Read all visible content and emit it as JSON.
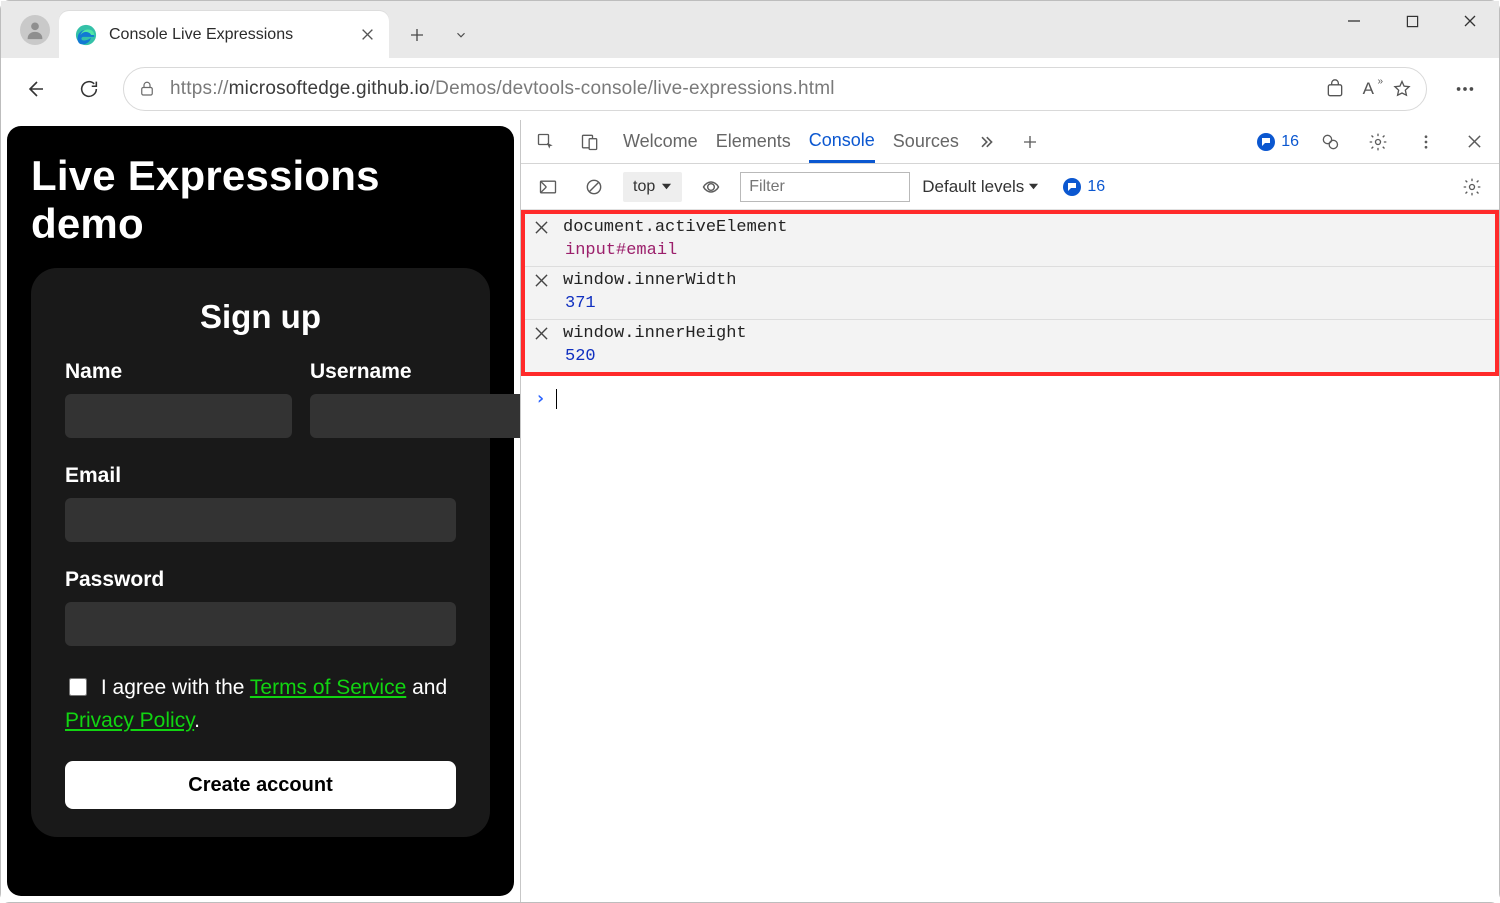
{
  "browser": {
    "tab_title": "Console Live Expressions",
    "url_scheme": "https://",
    "url_host": "microsoftedge.github.io",
    "url_path": "/Demos/devtools-console/live-expressions.html"
  },
  "page": {
    "heading": "Live Expressions demo",
    "form": {
      "title": "Sign up",
      "name_label": "Name",
      "username_label": "Username",
      "email_label": "Email",
      "password_label": "Password",
      "agree_prefix": "I agree with the ",
      "tos_link": "Terms of Service",
      "agree_mid": " and ",
      "privacy_link": "Privacy Policy",
      "agree_suffix": ".",
      "submit_label": "Create account"
    }
  },
  "devtools": {
    "tabs": {
      "welcome": "Welcome",
      "elements": "Elements",
      "console": "Console",
      "sources": "Sources"
    },
    "issues_count": "16",
    "console": {
      "context_label": "top",
      "filter_placeholder": "Filter",
      "levels_label": "Default levels",
      "issues_count": "16",
      "live_expressions": [
        {
          "expr": "document.activeElement",
          "result": "input#email",
          "type": "object"
        },
        {
          "expr": "window.innerWidth",
          "result": "371",
          "type": "number"
        },
        {
          "expr": "window.innerHeight",
          "result": "520",
          "type": "number"
        }
      ]
    }
  }
}
